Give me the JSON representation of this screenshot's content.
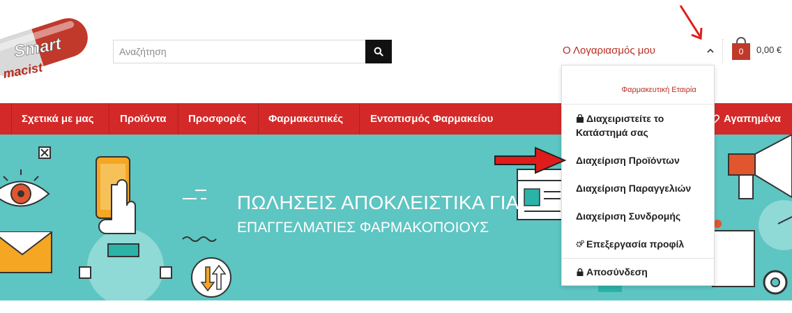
{
  "logo": {
    "line1": "Smart",
    "line2": "macist"
  },
  "search": {
    "placeholder": "Αναζήτηση"
  },
  "header": {
    "account_label": "Ο Λογαριασμός μου",
    "cart_count": "0",
    "cart_total": "0,00 €"
  },
  "nav": {
    "items": [
      {
        "label": "Σχετικά με μας"
      },
      {
        "label": "Προϊόντα"
      },
      {
        "label": "Προσφορές"
      },
      {
        "label": "Φαρμακευτικές"
      },
      {
        "label": "Εντοπισμός Φαρμακείου"
      }
    ],
    "favorites_label": "Αγαπημένα"
  },
  "banner": {
    "headline_line1": "ΠΩΛΗΣΕΙΣ ΑΠΟΚΛΕΙΣΤΙΚΑ ΓΙΑ",
    "headline_line2": "ΕΠΑΓΓΕΛΜΑΤΙΕΣ ΦΑΡΜΑΚΟΠΟΙΟΥΣ"
  },
  "dropdown": {
    "company_type": "Φαρμακευτική Εταιρία",
    "items": [
      {
        "label": "Διαχειριστείτε το Κατάστημά σας",
        "icon": "shopping-bag-icon"
      },
      {
        "label": "Διαχείριση Προϊόντων"
      },
      {
        "label": "Διαχείριση Παραγγελιών"
      },
      {
        "label": "Διαχείριση Συνδρομής"
      },
      {
        "label": "Επεξεργασία προφίλ",
        "icon": "gears-icon"
      },
      {
        "label": "Αποσύνδεση",
        "icon": "lock-icon"
      }
    ]
  },
  "colors": {
    "brand_red": "#d42929",
    "account_red": "#b82e21",
    "banner_teal": "#5dc5c2"
  }
}
